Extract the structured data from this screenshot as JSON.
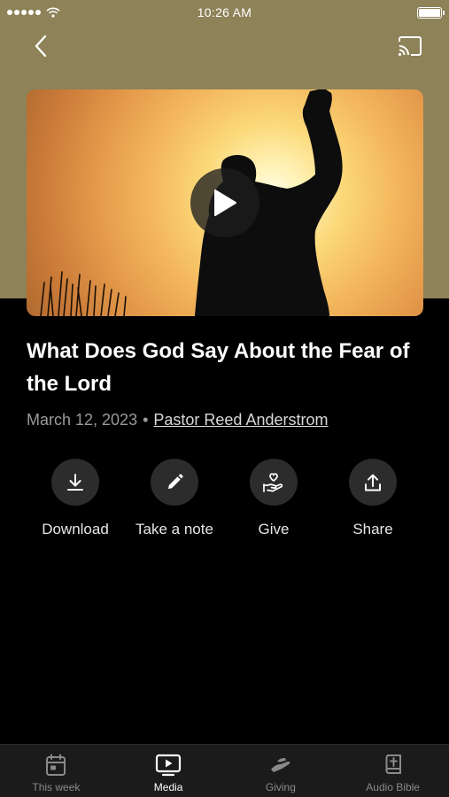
{
  "status_bar": {
    "time": "10:26 AM"
  },
  "header": {
    "back_icon": "chevron-left-icon",
    "cast_icon": "cast-icon",
    "band_color": "#8e8259"
  },
  "media": {
    "title": "What Does God Say About the Fear of the Lord",
    "date": "March 12, 2023",
    "separator": "•",
    "author": "Pastor Reed Anderstrom"
  },
  "actions": [
    {
      "label": "Download",
      "icon": "download-icon"
    },
    {
      "label": "Take a note",
      "icon": "pencil-icon"
    },
    {
      "label": "Give",
      "icon": "give-heart-hand-icon"
    },
    {
      "label": "Share",
      "icon": "share-icon"
    }
  ],
  "tabs": [
    {
      "label": "This week",
      "icon": "calendar-icon",
      "active": false
    },
    {
      "label": "Media",
      "icon": "media-player-icon",
      "active": true
    },
    {
      "label": "Giving",
      "icon": "giving-hand-icon",
      "active": false
    },
    {
      "label": "Audio Bible",
      "icon": "bible-icon",
      "active": false
    }
  ],
  "colors": {
    "background": "#000000",
    "tabbar": "#1b1b1b",
    "action_circle": "#2c2c2c",
    "muted_text": "#9a9a9a"
  }
}
